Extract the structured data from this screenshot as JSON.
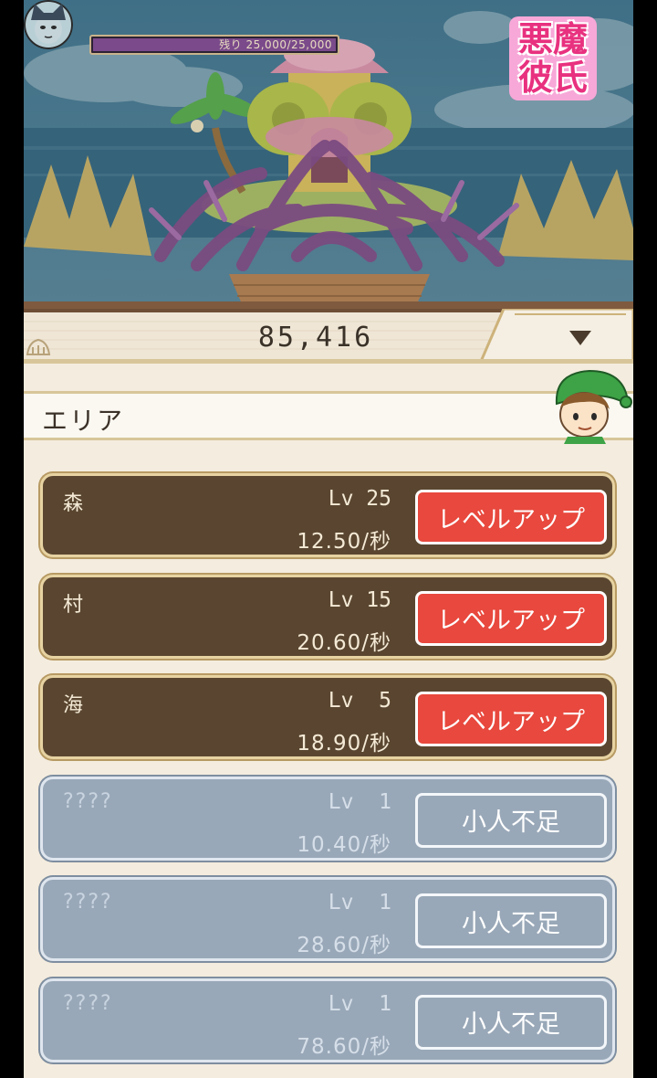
{
  "boss": {
    "hp_label": "残り 25,000/25,000",
    "hp_fraction": 1.0
  },
  "logo": {
    "line1": "悪魔",
    "line2": "彼氏"
  },
  "currency": {
    "value": "85,416"
  },
  "panel": {
    "title": "エリア"
  },
  "areas": [
    {
      "name": "森",
      "level": "Lv 25",
      "rate": "12.50/秒",
      "button": "レベルアップ",
      "locked": false
    },
    {
      "name": "村",
      "level": "Lv 15",
      "rate": "20.60/秒",
      "button": "レベルアップ",
      "locked": false
    },
    {
      "name": "海",
      "level": "Lv  5",
      "rate": "18.90/秒",
      "button": "レベルアップ",
      "locked": false
    },
    {
      "name": "????",
      "level": "Lv  1",
      "rate": "10.40/秒",
      "button": "小人不足",
      "locked": true
    },
    {
      "name": "????",
      "level": "Lv  1",
      "rate": "28.60/秒",
      "button": "小人不足",
      "locked": true
    },
    {
      "name": "????",
      "level": "Lv  1",
      "rate": "78.60/秒",
      "button": "小人不足",
      "locked": true
    }
  ],
  "colors": {
    "levelup_button": "#e8483d",
    "unlocked_row": "#5a4630",
    "locked_row": "#99a8b8",
    "logo_pink": "#e8317f"
  }
}
